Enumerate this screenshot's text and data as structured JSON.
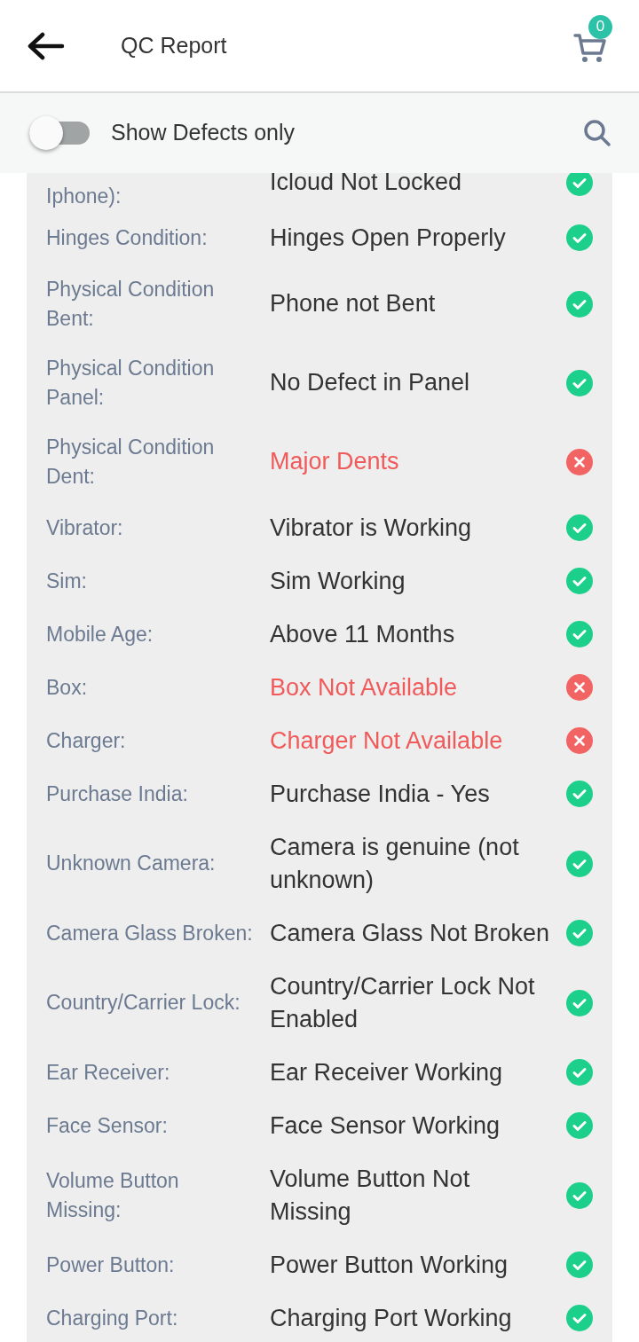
{
  "header": {
    "title": "QC Report",
    "cart_count": "0"
  },
  "filter": {
    "label": "Show Defects only",
    "on": false
  },
  "rows": [
    {
      "label": "Iphone):",
      "value": "Icloud Not Locked",
      "defect": false
    },
    {
      "label": "Hinges Condition:",
      "value": "Hinges Open Properly",
      "defect": false
    },
    {
      "label": "Physical Condition Bent:",
      "value": "Phone not Bent",
      "defect": false
    },
    {
      "label": "Physical Condition Panel:",
      "value": "No Defect in Panel",
      "defect": false
    },
    {
      "label": "Physical Condition Dent:",
      "value": "Major Dents",
      "defect": true
    },
    {
      "label": "Vibrator:",
      "value": "Vibrator is Working",
      "defect": false
    },
    {
      "label": "Sim:",
      "value": "Sim Working",
      "defect": false
    },
    {
      "label": "Mobile Age:",
      "value": "Above 11 Months",
      "defect": false
    },
    {
      "label": "Box:",
      "value": "Box Not Available",
      "defect": true
    },
    {
      "label": "Charger:",
      "value": "Charger Not Available",
      "defect": true
    },
    {
      "label": "Purchase India:",
      "value": "Purchase India - Yes",
      "defect": false
    },
    {
      "label": "Unknown Camera:",
      "value": "Camera is genuine (not unknown)",
      "defect": false
    },
    {
      "label": "Camera Glass Broken:",
      "value": "Camera Glass Not Broken",
      "defect": false
    },
    {
      "label": "Country/Carrier Lock:",
      "value": "Country/Carrier Lock Not Enabled",
      "defect": false
    },
    {
      "label": "Ear Receiver:",
      "value": "Ear Receiver Working",
      "defect": false
    },
    {
      "label": "Face Sensor:",
      "value": "Face Sensor Working",
      "defect": false
    },
    {
      "label": "Volume Button Missing:",
      "value": "Volume Button Not Missing",
      "defect": false
    },
    {
      "label": "Power Button:",
      "value": "Power Button Working",
      "defect": false
    },
    {
      "label": "Charging Port:",
      "value": "Charging Port Working",
      "defect": false
    }
  ]
}
